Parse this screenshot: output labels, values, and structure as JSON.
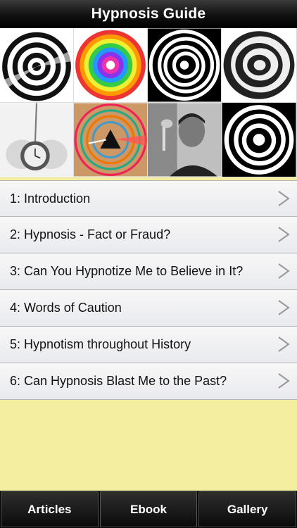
{
  "header": {
    "title": "Hypnosis Guide"
  },
  "gallery": {
    "tiles": [
      {
        "name": "spiral-bw-1"
      },
      {
        "name": "spiral-rainbow"
      },
      {
        "name": "spiral-bw-2"
      },
      {
        "name": "spiral-bw-3"
      },
      {
        "name": "pocket-watch"
      },
      {
        "name": "prism-pattern"
      },
      {
        "name": "hypnotist-photo"
      },
      {
        "name": "spiral-bw-4"
      }
    ]
  },
  "chapters": [
    {
      "label": "1: Introduction"
    },
    {
      "label": "2: Hypnosis - Fact or Fraud?"
    },
    {
      "label": "3: Can You Hypnotize Me to Believe in It?"
    },
    {
      "label": "4: Words of Caution"
    },
    {
      "label": "5: Hypnotism throughout History"
    },
    {
      "label": "6: Can Hypnosis Blast Me to the Past?"
    }
  ],
  "tabs": [
    {
      "label": "Articles"
    },
    {
      "label": "Ebook"
    },
    {
      "label": "Gallery"
    }
  ],
  "colors": {
    "background": "#f3ef9e",
    "bar": "#000000"
  }
}
